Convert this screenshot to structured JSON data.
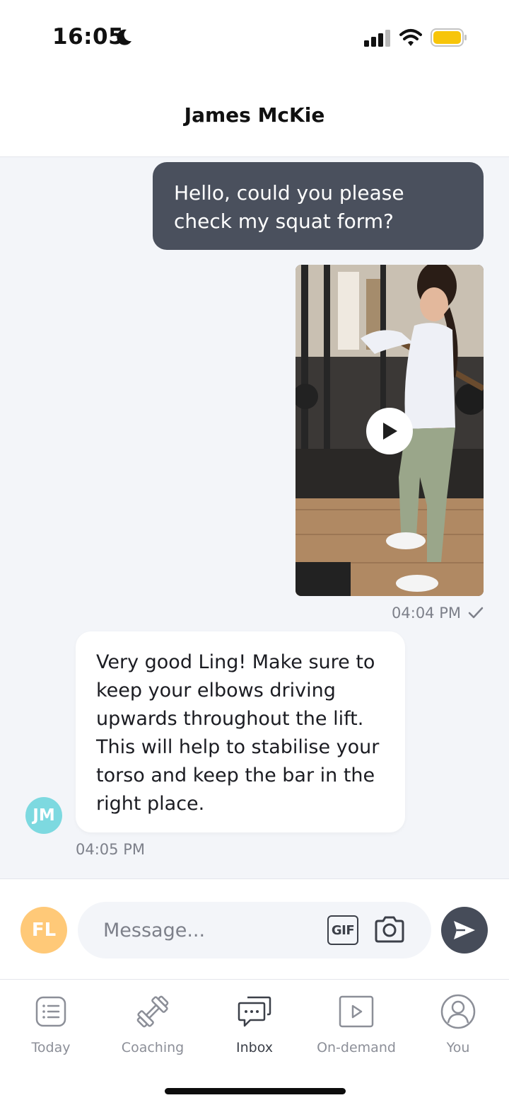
{
  "status_bar": {
    "time": "16:05",
    "icons": [
      "moon-icon",
      "signal-icon",
      "wifi-icon",
      "battery-icon"
    ],
    "battery_color": "#f7c50a"
  },
  "header": {
    "title": "James McKie"
  },
  "messages": {
    "outgoing_text": "Hello, could you please check my squat form?",
    "outgoing_time": "04:04 PM",
    "incoming_text": "Very good Ling! Make sure to keep your elbows driving upwards throughout the lift. This will help to stabilise your torso and keep the bar in the right place.",
    "incoming_time": "04:05 PM",
    "incoming_avatar": "JM"
  },
  "composer": {
    "avatar": "FL",
    "placeholder": "Message...",
    "gif_label": "GIF"
  },
  "nav": {
    "items": [
      {
        "label": "Today",
        "icon": "list-icon"
      },
      {
        "label": "Coaching",
        "icon": "dumbbell-icon"
      },
      {
        "label": "Inbox",
        "icon": "chat-icon"
      },
      {
        "label": "On-demand",
        "icon": "play-icon"
      },
      {
        "label": "You",
        "icon": "user-icon"
      }
    ],
    "active": "Inbox"
  },
  "colors": {
    "outgoing_bubble": "#4a505d",
    "chat_background": "#f3f5f9",
    "coach_avatar": "#7dd9e0",
    "user_avatar": "#ffc978",
    "send_button": "#464c59"
  }
}
